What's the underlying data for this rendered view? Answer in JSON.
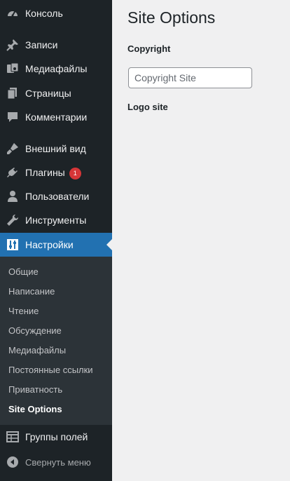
{
  "sidebar": {
    "items": [
      {
        "label": "Консоль",
        "icon": "dashboard-icon"
      },
      {
        "label": "Записи",
        "icon": "pin-icon"
      },
      {
        "label": "Медиафайлы",
        "icon": "media-icon"
      },
      {
        "label": "Страницы",
        "icon": "pages-icon"
      },
      {
        "label": "Комментарии",
        "icon": "comments-icon"
      },
      {
        "label": "Внешний вид",
        "icon": "appearance-icon"
      },
      {
        "label": "Плагины",
        "icon": "plugins-icon",
        "badge": "1"
      },
      {
        "label": "Пользователи",
        "icon": "users-icon"
      },
      {
        "label": "Инструменты",
        "icon": "tools-icon"
      },
      {
        "label": "Настройки",
        "icon": "settings-icon",
        "current": true
      },
      {
        "label": "Группы полей",
        "icon": "field-groups-icon"
      }
    ],
    "submenu": [
      "Общие",
      "Написание",
      "Чтение",
      "Обсуждение",
      "Медиафайлы",
      "Постоянные ссылки",
      "Приватность",
      "Site Options"
    ],
    "submenu_active": "Site Options",
    "collapse_label": "Свернуть меню"
  },
  "main": {
    "title": "Site Options",
    "copyright_label": "Copyright",
    "copyright_placeholder": "Copyright Site",
    "copyright_value": "",
    "logo_label": "Logo site"
  },
  "colors": {
    "sidebar_bg": "#1d2327",
    "submenu_bg": "#2c3338",
    "current_bg": "#2271b1",
    "badge_bg": "#d63638",
    "page_bg": "#f0f0f1"
  }
}
